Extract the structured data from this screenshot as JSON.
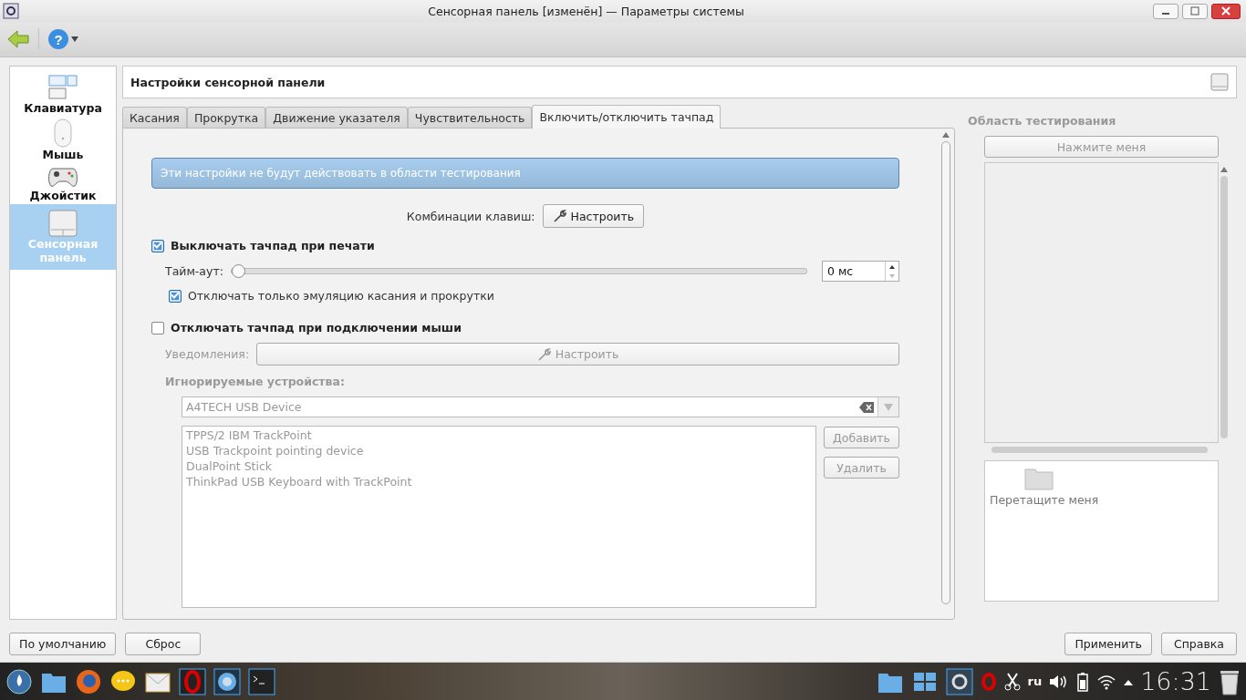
{
  "window": {
    "title": "Сенсорная панель [изменён] — Параметры системы"
  },
  "toolbar": {
    "help_glyph": "?"
  },
  "sidebar": {
    "items": [
      {
        "label": "Клавиатура",
        "kind": "keyboard",
        "selected": false
      },
      {
        "label": "Мышь",
        "kind": "mouse",
        "selected": false
      },
      {
        "label": "Джойстик",
        "kind": "joystick",
        "selected": false
      },
      {
        "label": "Сенсорная панель",
        "kind": "touchpad",
        "selected": true
      }
    ]
  },
  "header": {
    "title": "Настройки сенсорной панели"
  },
  "tabs": [
    {
      "label": "Касания",
      "selected": false
    },
    {
      "label": "Прокрутка",
      "selected": false
    },
    {
      "label": "Движение указателя",
      "selected": false
    },
    {
      "label": "Чувствительность",
      "selected": false
    },
    {
      "label": "Включить/отключить тачпад",
      "selected": true
    }
  ],
  "panel": {
    "info_message": "Эти настройки не будут действовать в области тестирования",
    "shortcut": {
      "label": "Комбинации клавиш:",
      "button": "Настроить"
    },
    "disable_typing": {
      "label": "Выключать тачпад при печати",
      "checked": true
    },
    "timeout": {
      "label": "Тайм-аут:",
      "level": 0,
      "value": "0 мс"
    },
    "emulation_only": {
      "label": "Отключать только эмуляцию касания и прокрутки",
      "checked": true
    },
    "disable_mouse": {
      "label": "Отключать тачпад при подключении мыши",
      "checked": false
    },
    "notifications": {
      "label": "Уведомления:",
      "button": "Настроить"
    },
    "ignored": {
      "title": "Игнорируемые устройства:",
      "combo_value": "A4TECH USB Device",
      "devices": [
        "TPPS/2 IBM TrackPoint",
        "USB Trackpoint pointing device",
        "DualPoint Stick",
        "ThinkPad USB Keyboard with TrackPoint"
      ],
      "add_button": "Добавить",
      "remove_button": "Удалить"
    }
  },
  "test_area": {
    "title": "Область тестирования",
    "button": "Нажмите меня",
    "drag_label": "Перетащите меня"
  },
  "buttons": {
    "defaults": "По умолчанию",
    "reset": "Сброс",
    "apply": "Применить",
    "help": "Справка"
  },
  "taskbar": {
    "language": "ru",
    "clock": "16:31"
  }
}
